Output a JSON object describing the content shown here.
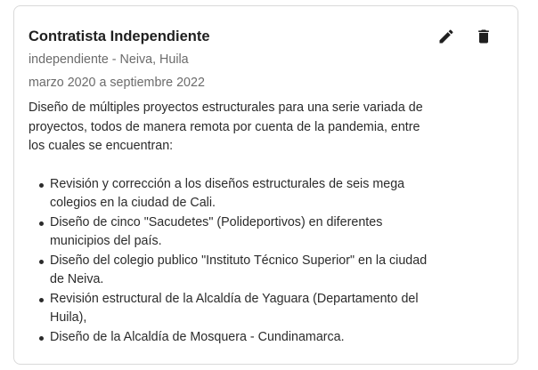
{
  "entry": {
    "title": "Contratista Independiente",
    "subtitle": "independiente - Neiva, Huila",
    "dates": "marzo 2020 a septiembre 2022",
    "description": "Diseño de múltiples proyectos estructurales para una serie variada de proyectos, todos de manera remota por cuenta de la pandemia, entre los cuales se encuentran:",
    "items": [
      "Revisión y corrección a los diseños estructurales de seis mega colegios en la ciudad de Cali.",
      "Diseño de cinco \"Sacudetes\" (Polideportivos) en diferentes municipios del país.",
      "Diseño del colegio publico \"Instituto Técnico Superior\" en la ciudad de Neiva.",
      "Revisión estructural de la Alcaldía de Yaguara (Departamento del Huila),",
      "Diseño de la Alcaldía de Mosquera - Cundinamarca."
    ]
  },
  "actions": {
    "edit_icon": "pencil-icon",
    "delete_icon": "trash-icon",
    "icon_color": "#1f1f1f"
  }
}
